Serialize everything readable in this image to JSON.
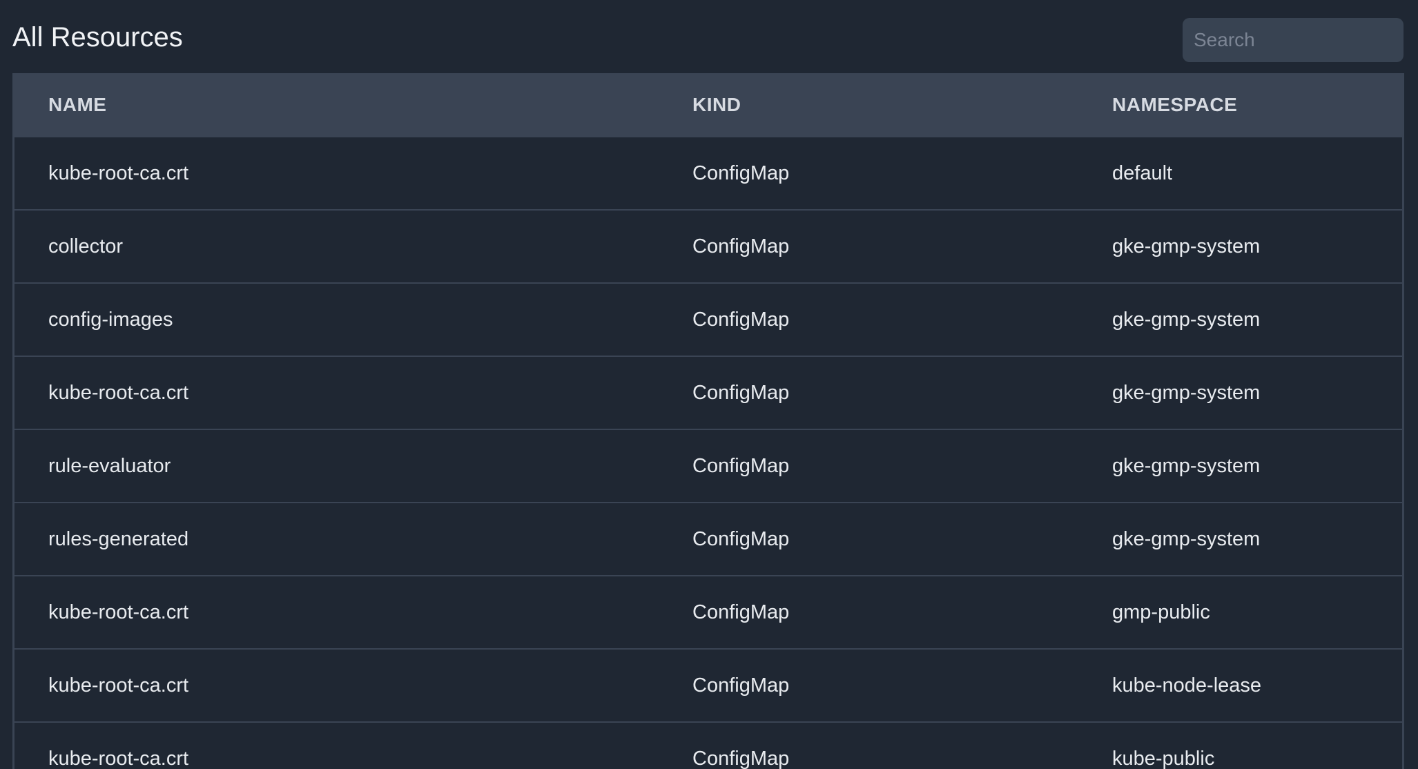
{
  "header": {
    "title": "All Resources",
    "search_placeholder": "Search"
  },
  "table": {
    "columns": [
      "NAME",
      "KIND",
      "NAMESPACE"
    ],
    "rows": [
      {
        "name": "kube-root-ca.crt",
        "kind": "ConfigMap",
        "namespace": "default"
      },
      {
        "name": "collector",
        "kind": "ConfigMap",
        "namespace": "gke-gmp-system"
      },
      {
        "name": "config-images",
        "kind": "ConfigMap",
        "namespace": "gke-gmp-system"
      },
      {
        "name": "kube-root-ca.crt",
        "kind": "ConfigMap",
        "namespace": "gke-gmp-system"
      },
      {
        "name": "rule-evaluator",
        "kind": "ConfigMap",
        "namespace": "gke-gmp-system"
      },
      {
        "name": "rules-generated",
        "kind": "ConfigMap",
        "namespace": "gke-gmp-system"
      },
      {
        "name": "kube-root-ca.crt",
        "kind": "ConfigMap",
        "namespace": "gmp-public"
      },
      {
        "name": "kube-root-ca.crt",
        "kind": "ConfigMap",
        "namespace": "kube-node-lease"
      },
      {
        "name": "kube-root-ca.crt",
        "kind": "ConfigMap",
        "namespace": "kube-public"
      }
    ]
  },
  "colors": {
    "background": "#1f2733",
    "header_row": "#3a4454",
    "search_bg": "#384352",
    "row_divider": "#3a4454"
  }
}
